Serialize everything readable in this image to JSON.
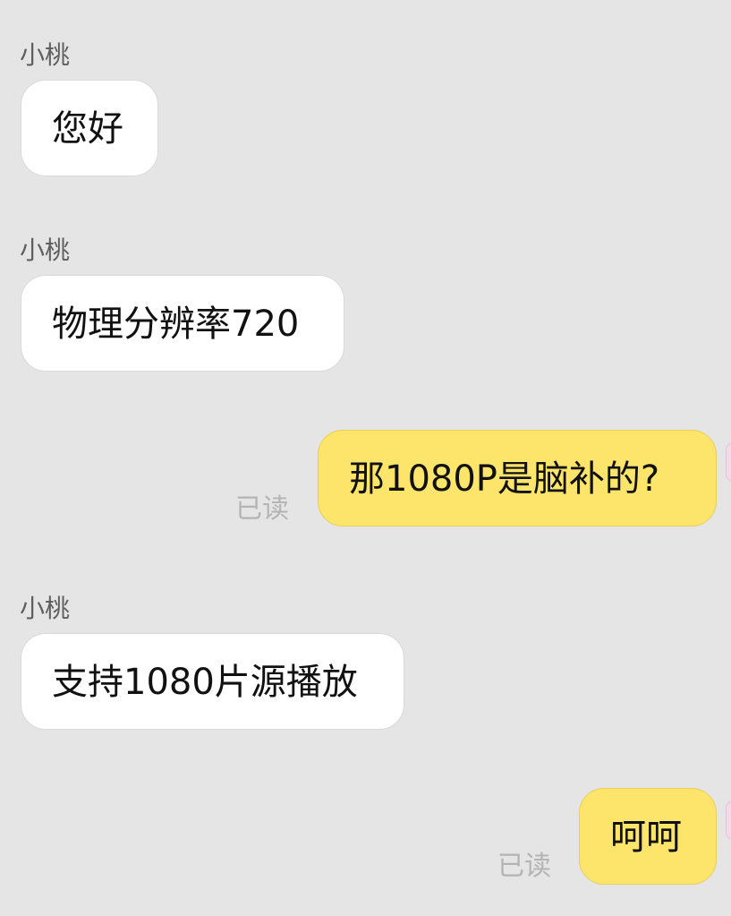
{
  "conversation": {
    "messages": [
      {
        "direction": "incoming",
        "sender": "小桃",
        "text": "您好"
      },
      {
        "direction": "incoming",
        "sender": "小桃",
        "text": "物理分辨率720"
      },
      {
        "direction": "outgoing",
        "text": "那1080P是脑补的?",
        "status": "已读"
      },
      {
        "direction": "incoming",
        "sender": "小桃",
        "text": "支持1080片源播放"
      },
      {
        "direction": "outgoing",
        "text": "呵呵",
        "status": "已读"
      }
    ]
  },
  "colors": {
    "background": "#e5e5e5",
    "incoming_bubble": "#ffffff",
    "outgoing_bubble": "#fde56b",
    "read_status": "#b4b4b4",
    "sender_name": "#5f5f5f"
  }
}
